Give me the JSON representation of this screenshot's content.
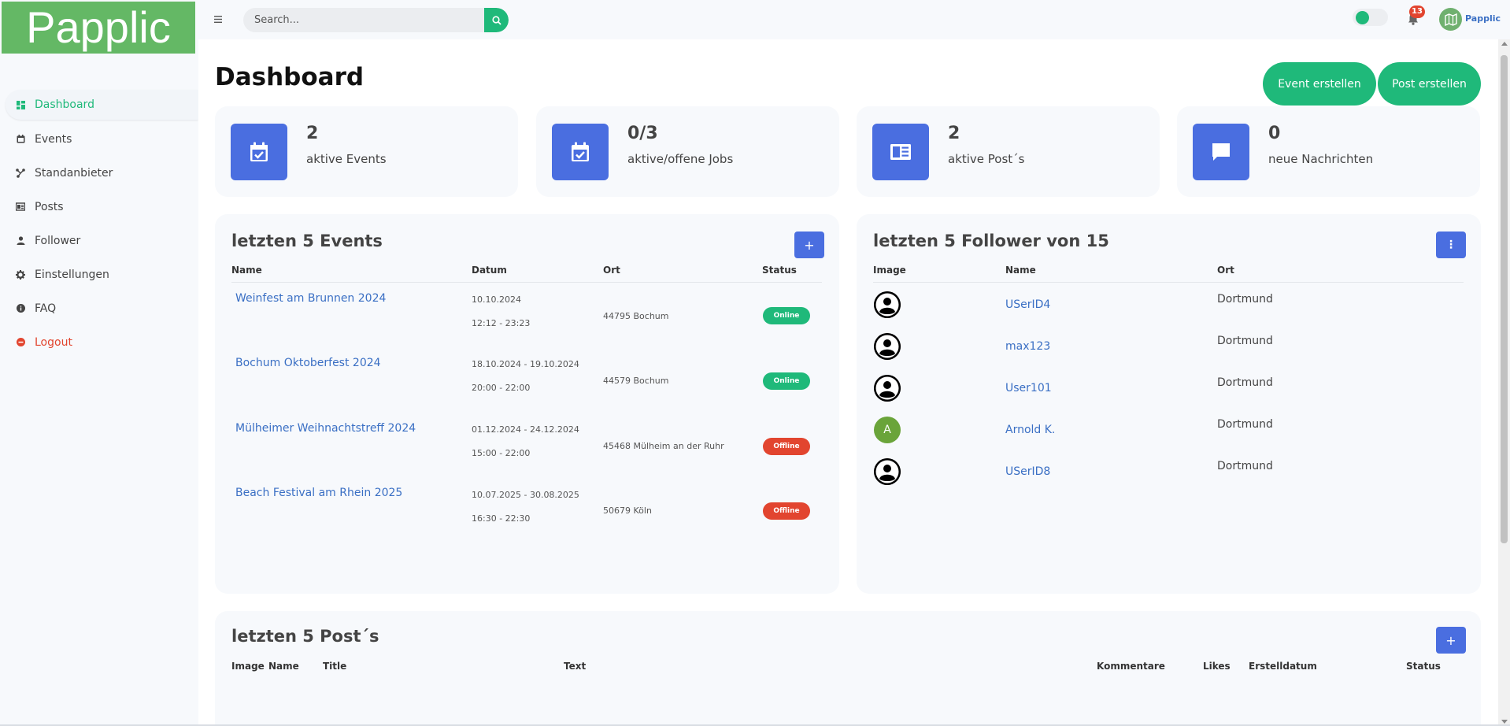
{
  "app": {
    "logo": "Papplic"
  },
  "sidebar": {
    "items": [
      {
        "label": "Dashboard",
        "icon": "dashboard-icon",
        "active": true
      },
      {
        "label": "Events",
        "icon": "calendar-icon"
      },
      {
        "label": "Standanbieter",
        "icon": "nodes-icon"
      },
      {
        "label": "Posts",
        "icon": "newspaper-icon"
      },
      {
        "label": "Follower",
        "icon": "person-icon"
      },
      {
        "label": "Einstellungen",
        "icon": "gear-icon"
      },
      {
        "label": "FAQ",
        "icon": "info-icon"
      },
      {
        "label": "Logout",
        "icon": "logout-icon"
      }
    ]
  },
  "topbar": {
    "search_placeholder": "Search...",
    "notification_count": "13",
    "user_name": "Papplic"
  },
  "page": {
    "title": "Dashboard",
    "btn_event": "Event erstellen",
    "btn_post": "Post erstellen"
  },
  "stats": [
    {
      "value": "2",
      "label": "aktive Events",
      "icon": "calendar-check-icon"
    },
    {
      "value": "0/3",
      "label": "aktive/offene Jobs",
      "icon": "calendar-check-icon"
    },
    {
      "value": "2",
      "label": "aktive Post´s",
      "icon": "newspaper-icon"
    },
    {
      "value": "0",
      "label": "neue Nachrichten",
      "icon": "chat-icon"
    }
  ],
  "events_panel": {
    "title": "letzten 5 Events",
    "add_label": "+",
    "headers": {
      "name": "Name",
      "datum": "Datum",
      "ort": "Ort",
      "status": "Status"
    },
    "rows": [
      {
        "name": "Weinfest am Brunnen 2024",
        "date": "10.10.2024",
        "time": "12:12 - 23:23",
        "ort": "44795 Bochum",
        "status": "Online"
      },
      {
        "name": "Bochum Oktoberfest 2024",
        "date": "18.10.2024 - 19.10.2024",
        "time": "20:00 - 22:00",
        "ort": "44579 Bochum",
        "status": "Online"
      },
      {
        "name": "Mülheimer Weihnachtstreff 2024",
        "date": "01.12.2024 - 24.12.2024",
        "time": "15:00 - 22:00",
        "ort": "45468 Mülheim an der Ruhr",
        "status": "Offline"
      },
      {
        "name": "Beach Festival am Rhein 2025",
        "date": "10.07.2025 - 30.08.2025",
        "time": "16:30 - 22:30",
        "ort": "50679 Köln",
        "status": "Offline"
      }
    ]
  },
  "followers_panel": {
    "title": "letzten 5 Follower von 15",
    "menu_label": "⋮",
    "headers": {
      "image": "Image",
      "name": "Name",
      "ort": "Ort"
    },
    "rows": [
      {
        "name": "USerID4",
        "ort": "Dortmund",
        "avatar": "default"
      },
      {
        "name": "max123",
        "ort": "Dortmund",
        "avatar": "default"
      },
      {
        "name": "User101",
        "ort": "Dortmund",
        "avatar": "default"
      },
      {
        "name": "Arnold K.",
        "ort": "Dortmund",
        "avatar": "A"
      },
      {
        "name": "USerID8",
        "ort": "Dortmund",
        "avatar": "default"
      }
    ]
  },
  "posts_panel": {
    "title": "letzten 5 Post´s",
    "add_label": "+",
    "headers": {
      "image": "Image",
      "name": "Name",
      "title": "Title",
      "text": "Text",
      "kommentare": "Kommentare",
      "likes": "Likes",
      "erstelldatum": "Erstelldatum",
      "status": "Status"
    }
  },
  "colors": {
    "accent": "#1fb97a",
    "primary": "#4a6ee0",
    "danger": "#e2452f",
    "logo_bg": "#64b865"
  }
}
